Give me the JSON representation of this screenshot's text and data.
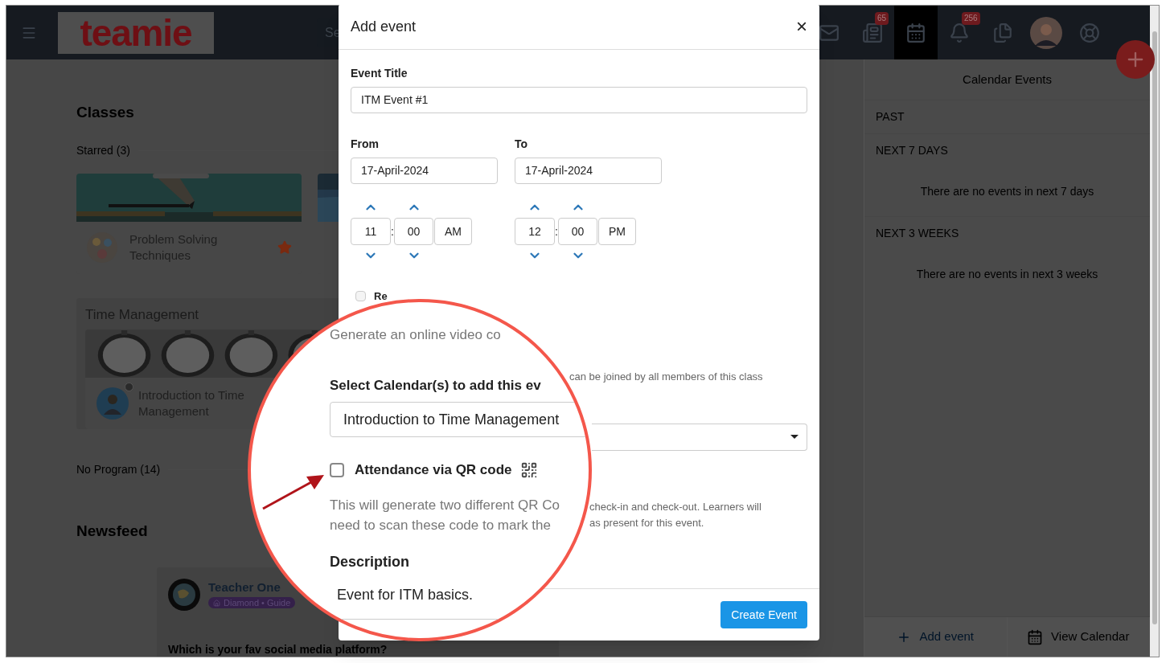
{
  "header": {
    "logo": "teamie",
    "search_placeholder": "Se",
    "icons": [
      {
        "kind": "mail",
        "selected": false
      },
      {
        "kind": "news",
        "badge": "65",
        "selected": false
      },
      {
        "kind": "calendar",
        "selected": true
      },
      {
        "kind": "bell",
        "badge": "256",
        "selected": false
      },
      {
        "kind": "files",
        "selected": false
      },
      {
        "kind": "avatar",
        "selected": false
      },
      {
        "kind": "help",
        "selected": false
      }
    ]
  },
  "classes": {
    "title": "Classes",
    "starred_label": "Starred (3)",
    "cards": [
      {
        "title": "Problem Solving Techniques",
        "starred": true
      },
      {
        "kind": "picture"
      }
    ]
  },
  "program_group": {
    "title": "Time Management",
    "card": {
      "title": "Introduction to Time Management"
    }
  },
  "no_program_label": "No Program (14)",
  "newsfeed": {
    "title": "Newsfeed",
    "post": {
      "author": "Teacher One",
      "badge": "Diamond • Guide",
      "question": "Which is your fav social media platform?"
    }
  },
  "calendar_panel": {
    "title": "Calendar Events",
    "sections": [
      {
        "label": "PAST"
      },
      {
        "label": "NEXT 7 DAYS",
        "empty_message": "There are no events in next 7 days"
      },
      {
        "label": "NEXT 3 WEEKS",
        "empty_message": "There are no events in next 3 weeks"
      }
    ],
    "buttons": [
      {
        "kind": "add",
        "label": "Add event"
      },
      {
        "kind": "calendar",
        "label": "View Calendar"
      }
    ]
  },
  "modal": {
    "title": "Add event",
    "close": "×",
    "event_title": {
      "label": "Event Title",
      "value": "ITM Event #1"
    },
    "times": [
      {
        "label": "From",
        "date": "17-April-2024",
        "hour": "11",
        "separator": ":",
        "minute": "00",
        "period": "AM"
      },
      {
        "label": "To",
        "date": "17-April-2024",
        "hour": "12",
        "separator": ":",
        "minute": "00",
        "period": "PM"
      }
    ],
    "repeat": {
      "label": "Re",
      "checked": false
    },
    "video_note_tail": "can be joined by all members of this class",
    "qr_note_tail": [
      "check-in and check-out. Learners will",
      "as present for this event."
    ],
    "submit": "Create Event"
  },
  "magnifier": {
    "video_text": "Generate an online video co",
    "calendar_label": "Select Calendar(s) to add this ev",
    "calendar_value": "Introduction to Time Management",
    "qr": {
      "label": "Attendance via QR code",
      "checked": false
    },
    "qr_note": [
      "This will generate two different QR Co",
      "need to scan these code to mark the"
    ],
    "description_label": "Description",
    "description": "Event for ITM basics."
  }
}
